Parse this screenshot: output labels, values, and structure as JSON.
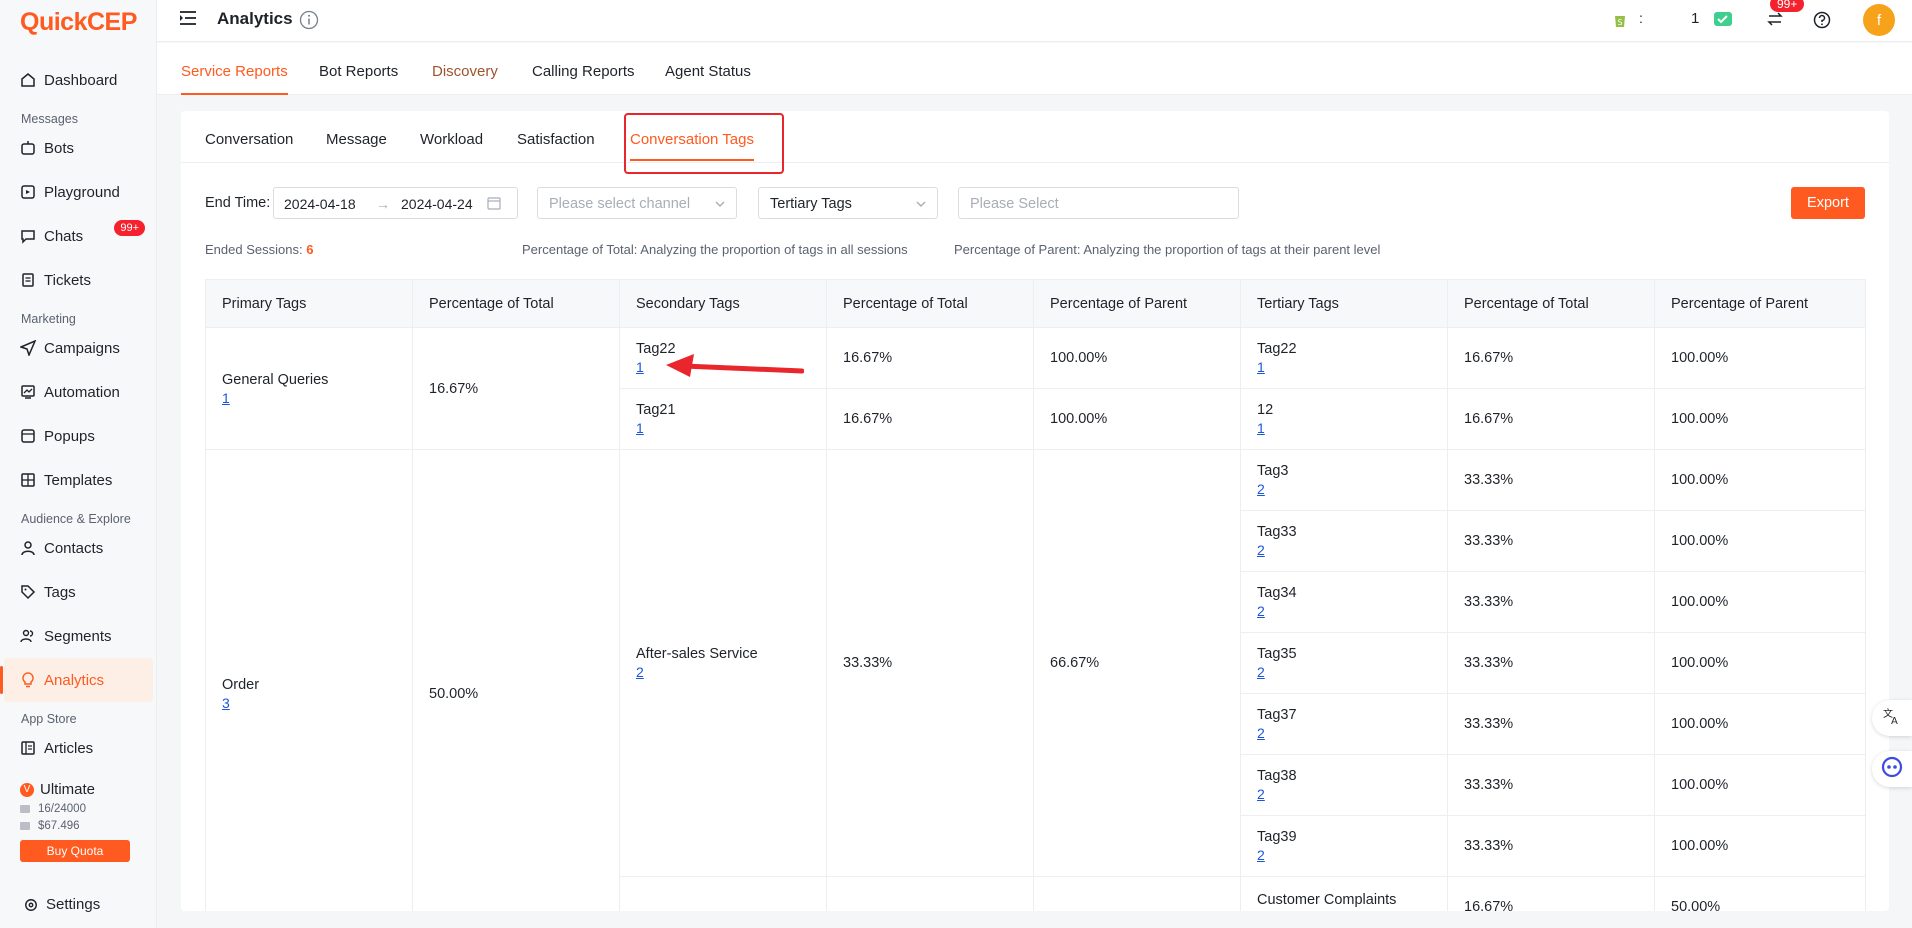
{
  "brand": {
    "logo_text_q": "Q",
    "logo_text_rest": "uickCEP",
    "accent": "#ff5a1f"
  },
  "sidebar": {
    "items": [
      {
        "label": "Dashboard",
        "icon": "home-icon"
      },
      {
        "section": "Messages"
      },
      {
        "label": "Bots",
        "icon": "bot-icon"
      },
      {
        "label": "Playground",
        "icon": "playground-icon"
      },
      {
        "label": "Chats",
        "icon": "chat-icon",
        "badge": "99+"
      },
      {
        "label": "Tickets",
        "icon": "ticket-icon"
      },
      {
        "section": "Marketing"
      },
      {
        "label": "Campaigns",
        "icon": "send-icon"
      },
      {
        "label": "Automation",
        "icon": "automation-icon"
      },
      {
        "label": "Popups",
        "icon": "popup-icon"
      },
      {
        "label": "Templates",
        "icon": "template-icon"
      },
      {
        "section": "Audience & Explore"
      },
      {
        "label": "Contacts",
        "icon": "user-icon"
      },
      {
        "label": "Tags",
        "icon": "tag-icon"
      },
      {
        "label": "Segments",
        "icon": "segments-icon"
      },
      {
        "label": "Analytics",
        "icon": "bulb-icon",
        "active": true
      },
      {
        "section": "App Store"
      },
      {
        "label": "Articles",
        "icon": "book-icon"
      }
    ],
    "plan": {
      "name": "Ultimate",
      "usage": "16/24000",
      "balance": "$67.496",
      "buy_label": "Buy Quota"
    },
    "settings_label": "Settings"
  },
  "topbar": {
    "title": "Analytics",
    "colon": ":",
    "count": "1",
    "notif_badge": "99+",
    "avatar_letter": "f"
  },
  "report_tabs": [
    "Service Reports",
    "Bot Reports",
    "Discovery",
    "Calling Reports",
    "Agent Status"
  ],
  "sub_tabs": [
    "Conversation",
    "Message",
    "Workload",
    "Satisfaction",
    "Conversation Tags"
  ],
  "filters": {
    "end_time_label": "End Time:",
    "start_date": "2024-04-18",
    "range_separator": "→",
    "end_date": "2024-04-24",
    "channel_placeholder": "Please select channel",
    "tag_level": "Tertiary Tags",
    "select_placeholder": "Please Select",
    "export_label": "Export"
  },
  "summary": {
    "ended_label": "Ended Sessions:",
    "ended_value": "6",
    "total_note": "Percentage of Total: Analyzing the proportion of tags in all sessions",
    "parent_note": "Percentage of Parent: Analyzing the proportion of tags at their parent level"
  },
  "table": {
    "headers": [
      "Primary Tags",
      "Percentage of Total",
      "Secondary Tags",
      "Percentage of Total",
      "Percentage of Parent",
      "Tertiary Tags",
      "Percentage of Total",
      "Percentage of Parent"
    ],
    "primary": [
      {
        "name": "General Queries",
        "count": "1",
        "pct": "16.67%"
      },
      {
        "name": "Order",
        "count": "3",
        "pct": "50.00%"
      }
    ],
    "secondary": [
      {
        "name": "Tag22",
        "count": "1",
        "pct_total": "16.67%",
        "pct_parent": "100.00%"
      },
      {
        "name": "Tag21",
        "count": "1",
        "pct_total": "16.67%",
        "pct_parent": "100.00%"
      },
      {
        "name": "After-sales Service",
        "count": "2",
        "pct_total": "33.33%",
        "pct_parent": "66.67%"
      }
    ],
    "tertiary": [
      {
        "name": "Tag22",
        "count": "1",
        "pct_total": "16.67%",
        "pct_parent": "100.00%"
      },
      {
        "name": "12",
        "count": "1",
        "pct_total": "16.67%",
        "pct_parent": "100.00%"
      },
      {
        "name": "Tag3",
        "count": "2",
        "pct_total": "33.33%",
        "pct_parent": "100.00%"
      },
      {
        "name": "Tag33",
        "count": "2",
        "pct_total": "33.33%",
        "pct_parent": "100.00%"
      },
      {
        "name": "Tag34",
        "count": "2",
        "pct_total": "33.33%",
        "pct_parent": "100.00%"
      },
      {
        "name": "Tag35",
        "count": "2",
        "pct_total": "33.33%",
        "pct_parent": "100.00%"
      },
      {
        "name": "Tag37",
        "count": "2",
        "pct_total": "33.33%",
        "pct_parent": "100.00%"
      },
      {
        "name": "Tag38",
        "count": "2",
        "pct_total": "33.33%",
        "pct_parent": "100.00%"
      },
      {
        "name": "Tag39",
        "count": "2",
        "pct_total": "33.33%",
        "pct_parent": "100.00%"
      },
      {
        "name": "Customer Complaints",
        "count": "",
        "pct_total": "16.67%",
        "pct_parent": "50.00%"
      }
    ]
  }
}
